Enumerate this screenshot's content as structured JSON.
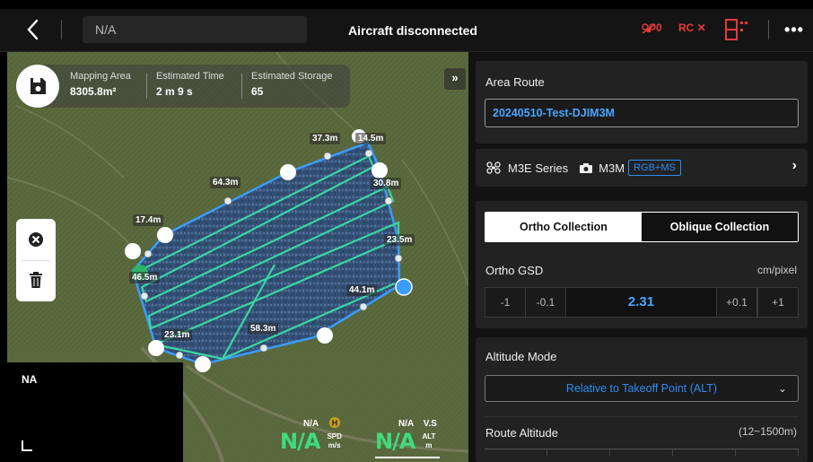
{
  "topbar": {
    "route_name_field": "N/A",
    "title": "Aircraft disconnected",
    "drone_status": "0",
    "rc_status": "RC ✕",
    "more_icon": "ellipsis-icon"
  },
  "map": {
    "stats": [
      {
        "label": "Mapping Area",
        "value": "8305.8m²"
      },
      {
        "label": "Estimated Time",
        "value": "2 m 9 s"
      },
      {
        "label": "Estimated Storage",
        "value": "65"
      }
    ],
    "collapse_label": "»",
    "distances": [
      "37.3m",
      "14.5m",
      "64.3m",
      "30.8m",
      "17.4m",
      "23.5m",
      "46.5m",
      "44.1m",
      "58.3m",
      "23.1m"
    ],
    "camera_label": "NA",
    "telemetry": {
      "top_left": "N/A",
      "top_right": "N/A",
      "vs_label": "V.S",
      "spd_value": "N/A",
      "spd_label": "SPD",
      "spd_unit": "m/s",
      "alt_value": "N/A",
      "alt_label": "ALT",
      "alt_unit": "m"
    }
  },
  "panel": {
    "route_label": "Area Route",
    "route_name": "20240510-Test-DJIM3M",
    "drone_series": "M3E Series",
    "camera": "M3M",
    "camera_mode": "RGB+MS",
    "tabs": [
      "Ortho Collection",
      "Oblique Collection"
    ],
    "gsd_label": "Ortho GSD",
    "gsd_unit": "cm/pixel",
    "gsd_steps": [
      "-1",
      "-0.1",
      "+0.1",
      "+1"
    ],
    "gsd_value": "2.31",
    "altitude_mode_label": "Altitude Mode",
    "altitude_mode_value": "Relative to Takeoff Point (ALT)",
    "route_altitude_label": "Route Altitude",
    "route_altitude_range": "(12~1500m)"
  },
  "colors": {
    "accent_blue": "#2d8cf0",
    "value_blue": "#4aa6ff",
    "route_green": "#3ad6a0",
    "telemetry_green": "#3ddc7c",
    "alert_red": "#e83a3a"
  }
}
